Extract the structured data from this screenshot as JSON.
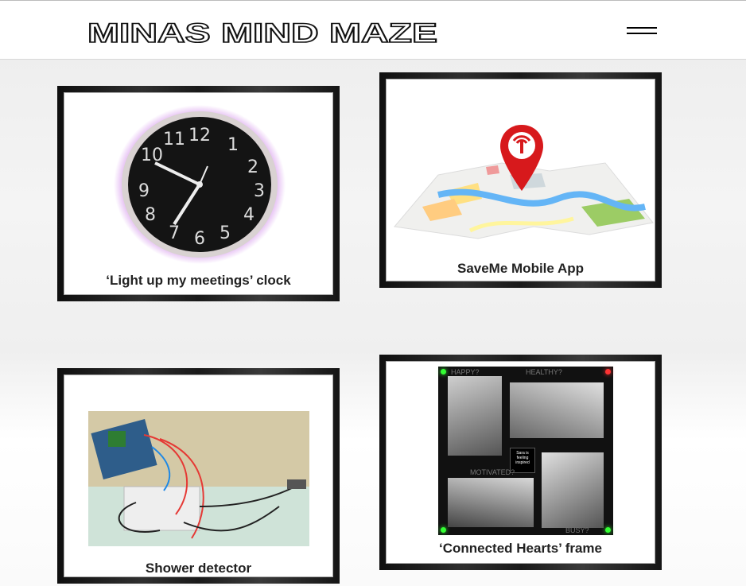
{
  "site": {
    "title": "MINAS MIND MAZE"
  },
  "header": {
    "menu_icon": "hamburger-menu-icon"
  },
  "projects": [
    {
      "caption": "‘Light up my meetings’ clock",
      "icon": "wall-clock-image"
    },
    {
      "caption": "SaveMe Mobile App",
      "icon": "map-pin-image"
    },
    {
      "caption": "Shower detector",
      "icon": "circuit-board-image"
    },
    {
      "caption": "‘Connected Hearts’ frame",
      "icon": "photo-frame-image"
    }
  ],
  "frame_labels": {
    "tl": "HAPPY?",
    "tr": "HEALTHY?",
    "bl": "MOTIVATED?",
    "br": "BUSY?",
    "center": "Sara is feeling inspired"
  },
  "colors": {
    "pin": "#d7191c",
    "clock_glow": "#c874e6",
    "frame_card": "#111111"
  }
}
